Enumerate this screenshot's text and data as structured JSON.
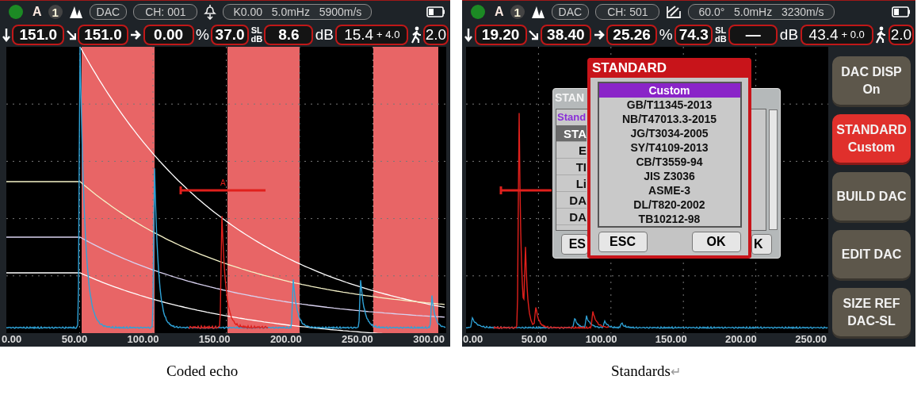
{
  "screens": [
    {
      "kind": "straight",
      "status": {
        "mode": "A",
        "probe_number": "1",
        "curve": "DAC",
        "channel": "CH: 001",
        "probe": "K0.00   5.0mHz   5900m/s"
      },
      "readings": [
        {
          "kind": "depth",
          "value": "151.0"
        },
        {
          "kind": "path",
          "value": "151.0"
        },
        {
          "kind": "surface",
          "value": "0.00"
        },
        {
          "kind": "amplitude",
          "label": "%",
          "value": "37.0"
        },
        {
          "kind": "sl",
          "label": "SL",
          "unit": "dB",
          "value": "8.6"
        },
        {
          "kind": "gain",
          "label": "dB",
          "value": "15.4",
          "offset": "+ 4.0"
        },
        {
          "kind": "step",
          "value": "2.0"
        }
      ],
      "plot": {
        "kind": "coded_echo",
        "gate_label": "A"
      },
      "x_ticks": [
        "0.00",
        "50.00",
        "100.00",
        "150.00",
        "200.00",
        "250.00",
        "300.00"
      ],
      "caption": "Coded echo"
    },
    {
      "kind": "angle",
      "status": {
        "mode": "A",
        "probe_number": "1",
        "curve": "DAC",
        "channel": "CH: 501",
        "probe": "60.0°   5.0mHz   3230m/s"
      },
      "readings": [
        {
          "kind": "depth",
          "value": "19.20"
        },
        {
          "kind": "path",
          "value": "38.40"
        },
        {
          "kind": "surface",
          "value": "25.26"
        },
        {
          "kind": "amplitude",
          "label": "%",
          "value": "74.3"
        },
        {
          "kind": "sl",
          "label": "SL",
          "unit": "dB",
          "value": "—"
        },
        {
          "kind": "gain",
          "label": "dB",
          "value": "43.4",
          "offset": "+ 0.0"
        },
        {
          "kind": "step",
          "value": "2.0"
        }
      ],
      "plot": {
        "kind": "standards"
      },
      "back_dialog": {
        "title": "STAN",
        "header": "Stand",
        "rows": [
          {
            "text": "STA",
            "selected": true
          },
          {
            "text": "E",
            "selected": false
          },
          {
            "text": "TI",
            "selected": false
          },
          {
            "text": "Li",
            "selected": false
          },
          {
            "text": "DA",
            "selected": false
          },
          {
            "text": "DA",
            "selected": false
          }
        ],
        "buttons": [
          "ES",
          "K"
        ]
      },
      "dialog": {
        "title": "STANDARD",
        "items": [
          {
            "text": "Custom",
            "selected": true
          },
          {
            "text": "GB/T11345-2013",
            "selected": false
          },
          {
            "text": "NB/T47013.3-2015",
            "selected": false
          },
          {
            "text": "JG/T3034-2005",
            "selected": false
          },
          {
            "text": "SY/T4109-2013",
            "selected": false
          },
          {
            "text": "CB/T3559-94",
            "selected": false
          },
          {
            "text": "JIS Z3036",
            "selected": false
          },
          {
            "text": "ASME-3",
            "selected": false
          },
          {
            "text": "DL/T820-2002",
            "selected": false
          },
          {
            "text": "TB10212-98",
            "selected": false
          }
        ],
        "buttons": [
          "ESC",
          "OK"
        ]
      },
      "side_buttons": [
        {
          "lines": [
            "DAC DISP",
            "On"
          ],
          "selected": false
        },
        {
          "lines": [
            "STANDARD",
            "Custom"
          ],
          "selected": true
        },
        {
          "lines": [
            "BUILD DAC"
          ],
          "selected": false
        },
        {
          "lines": [
            "EDIT DAC"
          ],
          "selected": false
        },
        {
          "lines": [
            "SIZE REF",
            "DAC-SL"
          ],
          "selected": false
        }
      ],
      "x_ticks": [
        "0.00",
        "50.00",
        "100.00",
        "150.00",
        "200.00",
        "250.00"
      ],
      "caption": "Standards",
      "caption_mark": "↵"
    }
  ]
}
